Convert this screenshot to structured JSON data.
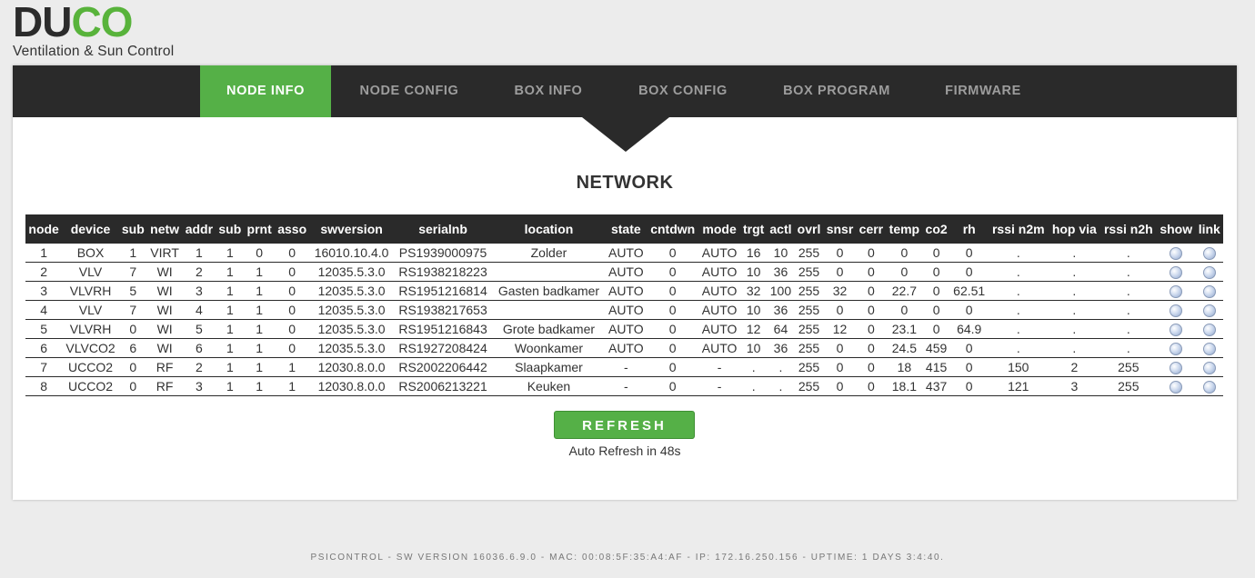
{
  "brand": {
    "logo_left": "DU",
    "logo_right": "CO",
    "tagline": "Ventilation & Sun Control"
  },
  "nav": {
    "tabs": [
      {
        "label": "NODE INFO",
        "active": true
      },
      {
        "label": "NODE CONFIG",
        "active": false
      },
      {
        "label": "BOX INFO",
        "active": false
      },
      {
        "label": "BOX CONFIG",
        "active": false
      },
      {
        "label": "BOX PROGRAM",
        "active": false
      },
      {
        "label": "FIRMWARE",
        "active": false
      }
    ]
  },
  "section_title": "NETWORK",
  "table": {
    "headers": [
      "node",
      "device",
      "sub",
      "netw",
      "addr",
      "sub",
      "prnt",
      "asso",
      "swversion",
      "serialnb",
      "location",
      "state",
      "cntdwn",
      "mode",
      "trgt",
      "actl",
      "ovrl",
      "snsr",
      "cerr",
      "temp",
      "co2",
      "rh",
      "rssi n2m",
      "hop via",
      "rssi n2h",
      "show",
      "link"
    ],
    "rows": [
      [
        "1",
        "BOX",
        "1",
        "VIRT",
        "1",
        "1",
        "0",
        "0",
        "16010.10.4.0",
        "PS1939000975",
        "Zolder",
        "AUTO",
        "0",
        "AUTO",
        "16",
        "10",
        "255",
        "0",
        "0",
        "0",
        "0",
        "0",
        ".",
        ".",
        "."
      ],
      [
        "2",
        "VLV",
        "7",
        "WI",
        "2",
        "1",
        "1",
        "0",
        "12035.5.3.0",
        "RS1938218223",
        "",
        "AUTO",
        "0",
        "AUTO",
        "10",
        "36",
        "255",
        "0",
        "0",
        "0",
        "0",
        "0",
        ".",
        ".",
        "."
      ],
      [
        "3",
        "VLVRH",
        "5",
        "WI",
        "3",
        "1",
        "1",
        "0",
        "12035.5.3.0",
        "RS1951216814",
        "Gasten badkamer",
        "AUTO",
        "0",
        "AUTO",
        "32",
        "100",
        "255",
        "32",
        "0",
        "22.7",
        "0",
        "62.51",
        ".",
        ".",
        "."
      ],
      [
        "4",
        "VLV",
        "7",
        "WI",
        "4",
        "1",
        "1",
        "0",
        "12035.5.3.0",
        "RS1938217653",
        "",
        "AUTO",
        "0",
        "AUTO",
        "10",
        "36",
        "255",
        "0",
        "0",
        "0",
        "0",
        "0",
        ".",
        ".",
        "."
      ],
      [
        "5",
        "VLVRH",
        "0",
        "WI",
        "5",
        "1",
        "1",
        "0",
        "12035.5.3.0",
        "RS1951216843",
        "Grote badkamer",
        "AUTO",
        "0",
        "AUTO",
        "12",
        "64",
        "255",
        "12",
        "0",
        "23.1",
        "0",
        "64.9",
        ".",
        ".",
        "."
      ],
      [
        "6",
        "VLVCO2",
        "6",
        "WI",
        "6",
        "1",
        "1",
        "0",
        "12035.5.3.0",
        "RS1927208424",
        "Woonkamer",
        "AUTO",
        "0",
        "AUTO",
        "10",
        "36",
        "255",
        "0",
        "0",
        "24.5",
        "459",
        "0",
        ".",
        ".",
        "."
      ],
      [
        "7",
        "UCCO2",
        "0",
        "RF",
        "2",
        "1",
        "1",
        "1",
        "12030.8.0.0",
        "RS2002206442",
        "Slaapkamer",
        "-",
        "0",
        "-",
        ".",
        ".",
        "255",
        "0",
        "0",
        "18",
        "415",
        "0",
        "150",
        "2",
        "255"
      ],
      [
        "8",
        "UCCO2",
        "0",
        "RF",
        "3",
        "1",
        "1",
        "1",
        "12030.8.0.0",
        "RS2006213221",
        "Keuken",
        "-",
        "0",
        "-",
        ".",
        ".",
        "255",
        "0",
        "0",
        "18.1",
        "437",
        "0",
        "121",
        "3",
        "255"
      ]
    ]
  },
  "actions": {
    "refresh_label": "REFRESH",
    "auto_refresh_text": "Auto Refresh in 48s"
  },
  "footer": "PSICONTROL - SW VERSION 16036.6.9.0 - MAC: 00:08:5F:35:A4:AF - IP: 172.16.250.156 - UPTIME: 1 DAYS 3:4:40.",
  "colors": {
    "accent": "#55b047",
    "dark": "#2a2a2a",
    "background": "#ececec"
  },
  "icons": {
    "show": "globe-dot-icon",
    "link": "globe-dot-icon"
  }
}
